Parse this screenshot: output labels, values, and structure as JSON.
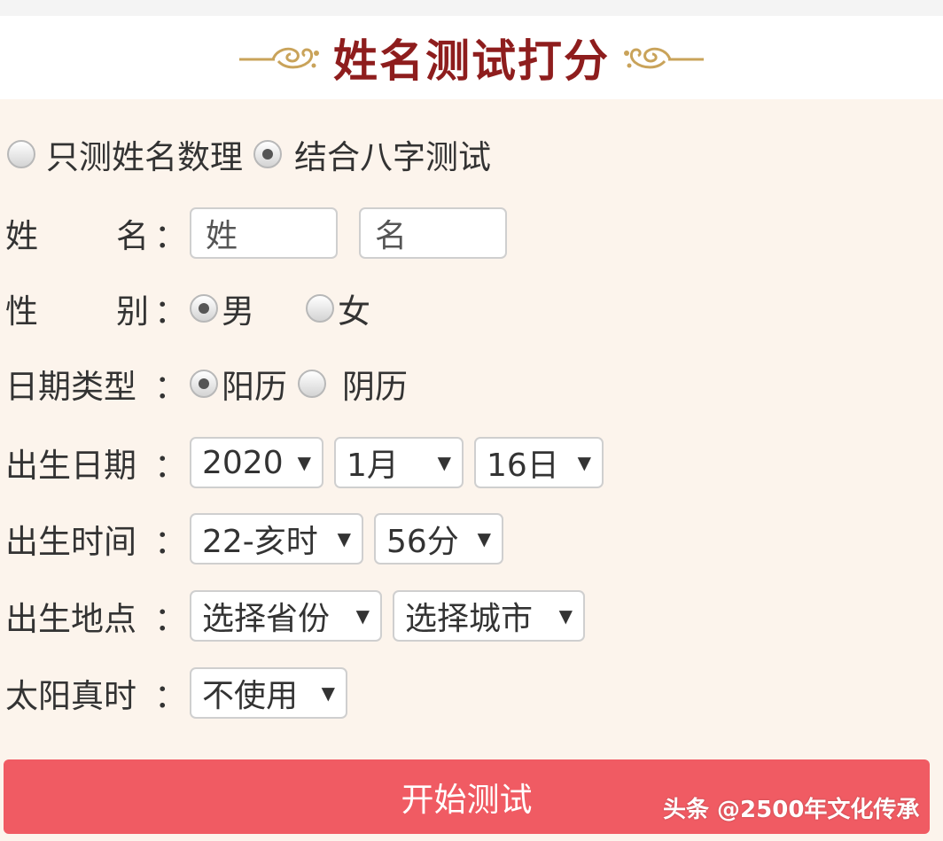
{
  "header": {
    "title": "姓名测试打分"
  },
  "mode": {
    "options": [
      "只测姓名数理",
      "结合八字测试"
    ],
    "selected_index": 1
  },
  "name_row": {
    "label_a": "姓",
    "label_b": "名",
    "colon": "：",
    "surname_placeholder": "姓",
    "given_placeholder": "名"
  },
  "gender_row": {
    "label_a": "性",
    "label_b": "别",
    "colon": "：",
    "options": [
      "男",
      "女"
    ],
    "selected_index": 0
  },
  "date_type_row": {
    "label": "日期类型",
    "colon": "：",
    "options": [
      "阳历",
      "阴历"
    ],
    "selected_index": 0
  },
  "birth_date_row": {
    "label": "出生日期",
    "colon": "：",
    "year": "2020",
    "month": "1月",
    "day": "16日"
  },
  "birth_time_row": {
    "label": "出生时间",
    "colon": "：",
    "hour": "22-亥时",
    "minute": "56分"
  },
  "birth_place_row": {
    "label": "出生地点",
    "colon": "：",
    "province": "选择省份",
    "city": "选择城市"
  },
  "solar_time_row": {
    "label": "太阳真时",
    "colon": "：",
    "value": "不使用"
  },
  "submit": {
    "label": "开始测试"
  },
  "watermark": {
    "text": "头条 @2500年文化传承"
  },
  "colors": {
    "title": "#8e1d1d",
    "panel_bg": "#fcf4ec",
    "button_bg": "#f05b63",
    "ornament": "#c9a35a"
  },
  "icons": {
    "dropdown": "▼",
    "ornament": "flourish-ornament"
  }
}
